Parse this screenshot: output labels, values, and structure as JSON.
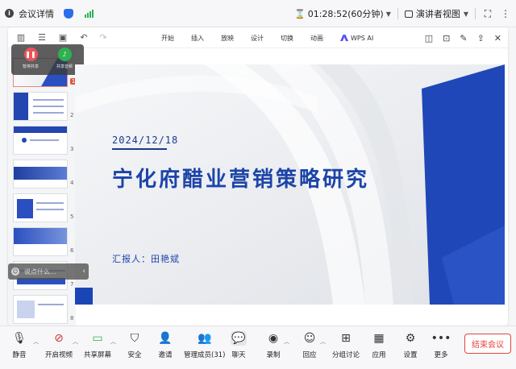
{
  "topbar": {
    "meeting_info_label": "会议详情",
    "timer": "01:28:52(60分钟)",
    "view_mode": "演讲者视图"
  },
  "wps": {
    "menu": [
      "开始",
      "插入",
      "放映",
      "设计",
      "切换",
      "动画"
    ],
    "ai_label": "WPS AI"
  },
  "float_widget": {
    "item1": "暂停共享",
    "item2": "共享音频"
  },
  "chat_bar": {
    "placeholder": "说点什么..."
  },
  "thumbnails": {
    "numbers": [
      "1",
      "2",
      "3",
      "4",
      "5",
      "6",
      "7",
      "8"
    ]
  },
  "slide": {
    "date": "2024/12/18",
    "title": "宁化府醋业营销策略研究",
    "reporter": "汇报人：田艳斌"
  },
  "bottombar": {
    "items": [
      "静音",
      "开启视频",
      "共享屏幕",
      "安全",
      "邀请",
      "管理成员(31)",
      "聊天",
      "录制",
      "回应",
      "分组讨论",
      "应用",
      "设置",
      "更多"
    ],
    "end_meeting": "结束会议"
  },
  "colors": {
    "accent": "#1c44a8",
    "end_red": "#e2453c",
    "signal_green": "#2cb24f"
  }
}
